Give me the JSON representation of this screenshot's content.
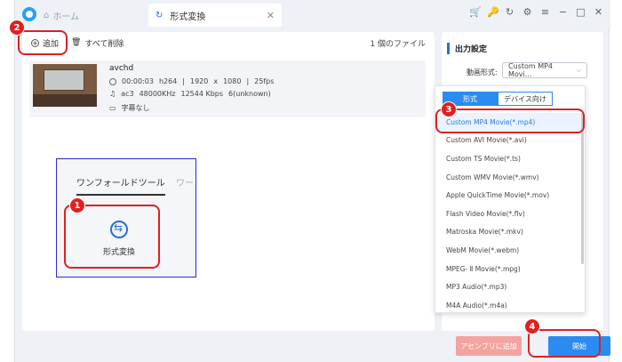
{
  "titlebar": {
    "home_tab": "ホーム",
    "active_tab": "形式変換",
    "close_glyph": "✕",
    "icons": [
      "cart-icon",
      "key-icon",
      "refresh-icon",
      "settings-icon",
      "menu-icon",
      "minimize-icon",
      "maximize-icon",
      "close-icon"
    ]
  },
  "toolbar": {
    "add_label": "追加",
    "delete_all_label": "すべて削除",
    "file_count": "1 個のファイル"
  },
  "file": {
    "name": "avchd",
    "duration": "00:00:03",
    "video_codec": "h264",
    "width": "1920",
    "x": "x",
    "height": "1080",
    "fps": "25fps",
    "audio_codec": "ac3",
    "sample_rate": "48000KHz",
    "bitrate": "12544 Kbps",
    "channels": "6(unknown)",
    "subtitle": "字幕なし",
    "sep": "|"
  },
  "tools": {
    "tab1": "ワンフォールドツール",
    "tab2": "ワー",
    "convert_label": "形式変換"
  },
  "output": {
    "title": "出力設定",
    "format_label": "動画形式:",
    "format_value": "Custom MP4 Movi...",
    "chevron": "⌵"
  },
  "dropdown": {
    "tab_format": "形式",
    "tab_device": "デバイス向け",
    "items": [
      "Custom MP4 Movie(*.mp4)",
      "Custom AVI Movie(*.avi)",
      "Custom TS Movie(*.ts)",
      "Custom WMV Movie(*.wmv)",
      "Apple QuickTime Movie(*.mov)",
      "Flash Video Movie(*.flv)",
      "Matroska Movie(*.mkv)",
      "WebM Movie(*.webm)",
      "MPEG- Ⅱ Movie(*.mpg)",
      "MP3 Audio(*.mp3)",
      "M4A Audio(*.m4a)"
    ]
  },
  "footer": {
    "assemble_label": "アセンブリに追加",
    "start_label": "開始"
  },
  "annotations": {
    "badge1": "1",
    "badge2": "2",
    "badge3": "3",
    "badge4": "4"
  },
  "colors": {
    "accent": "#2a8bf0",
    "annotation_red": "#e02020",
    "assemble_button": "#f4a4a0"
  }
}
